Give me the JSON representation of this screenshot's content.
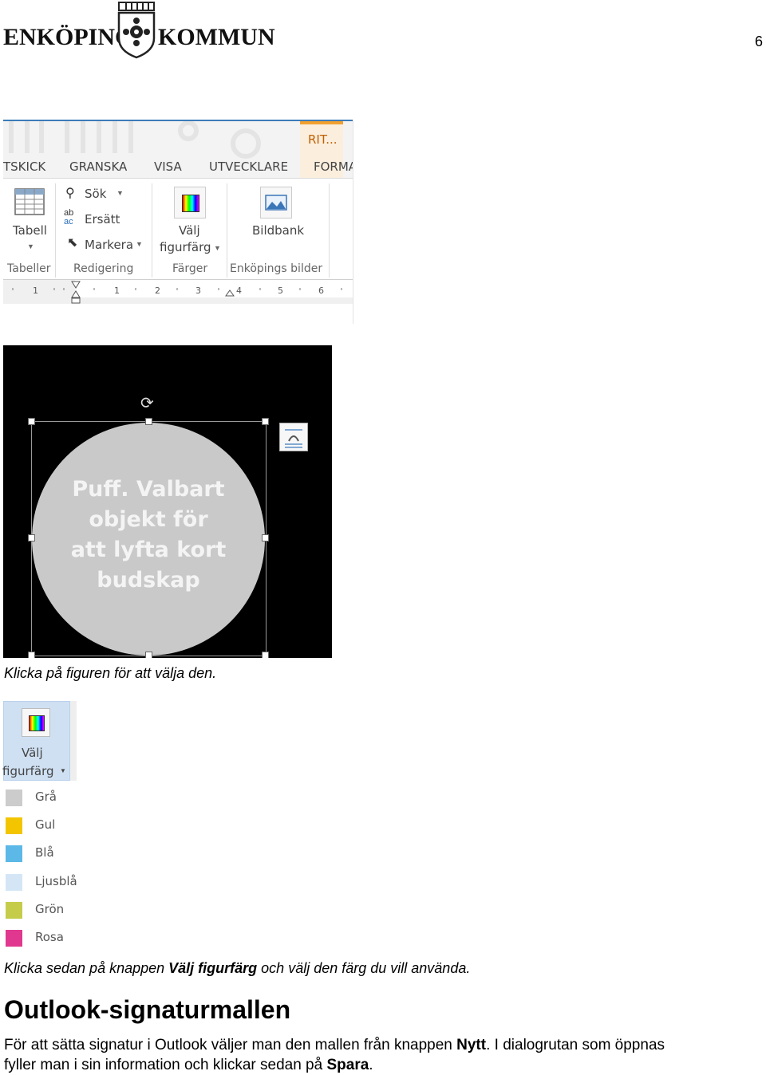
{
  "header": {
    "logo_left": "ENKÖPINGS",
    "logo_right": "KOMMUN",
    "page_number": "6"
  },
  "ribbon": {
    "tabs": [
      "TSKICK",
      "GRANSKA",
      "VISA",
      "UTVECKLARE",
      "FORMA"
    ],
    "contextual_tab": "RIT...",
    "buttons": {
      "table": "Tabell",
      "search": "Sök",
      "replace": "Ersätt",
      "select": "Markera",
      "shape_color_1": "Välj",
      "shape_color_2": "figurfärg",
      "image_bank": "Bildbank"
    },
    "groups": [
      "Tabeller",
      "Redigering",
      "Färger",
      "Enköpings bilder"
    ],
    "ruler_numbers": [
      "1",
      "1",
      "2",
      "3",
      "4",
      "5",
      "6"
    ]
  },
  "shape": {
    "lines": [
      "Puff. Valbart",
      "objekt för",
      "att lyfta kort",
      "budskap"
    ]
  },
  "caption1": "Klicka på figuren för att välja den.",
  "dropdown": {
    "button_line1": "Välj",
    "button_line2": "figurfärg",
    "options": [
      {
        "label": "Grå",
        "color": "#cccccc"
      },
      {
        "label": "Gul",
        "color": "#f2c500"
      },
      {
        "label": "Blå",
        "color": "#5cb8e6"
      },
      {
        "label": "Ljusblå",
        "color": "#d4e6f6"
      },
      {
        "label": "Grön",
        "color": "#c5cc4a"
      },
      {
        "label": "Rosa",
        "color": "#e0388e"
      }
    ]
  },
  "caption2": {
    "before": "Klicka sedan på knappen ",
    "bold": "Välj figurfärg",
    "after": " och välj den färg du vill använda."
  },
  "section": {
    "heading": "Outlook-signaturmallen",
    "p1_before": "För att sätta signatur i Outlook väljer man den mallen från knappen ",
    "p1_bold": "Nytt",
    "p1_after": ". I dialogrutan som öppnas",
    "p2_before": "fyller man i sin information och klickar sedan på ",
    "p2_bold": "Spara",
    "p2_after": "."
  }
}
